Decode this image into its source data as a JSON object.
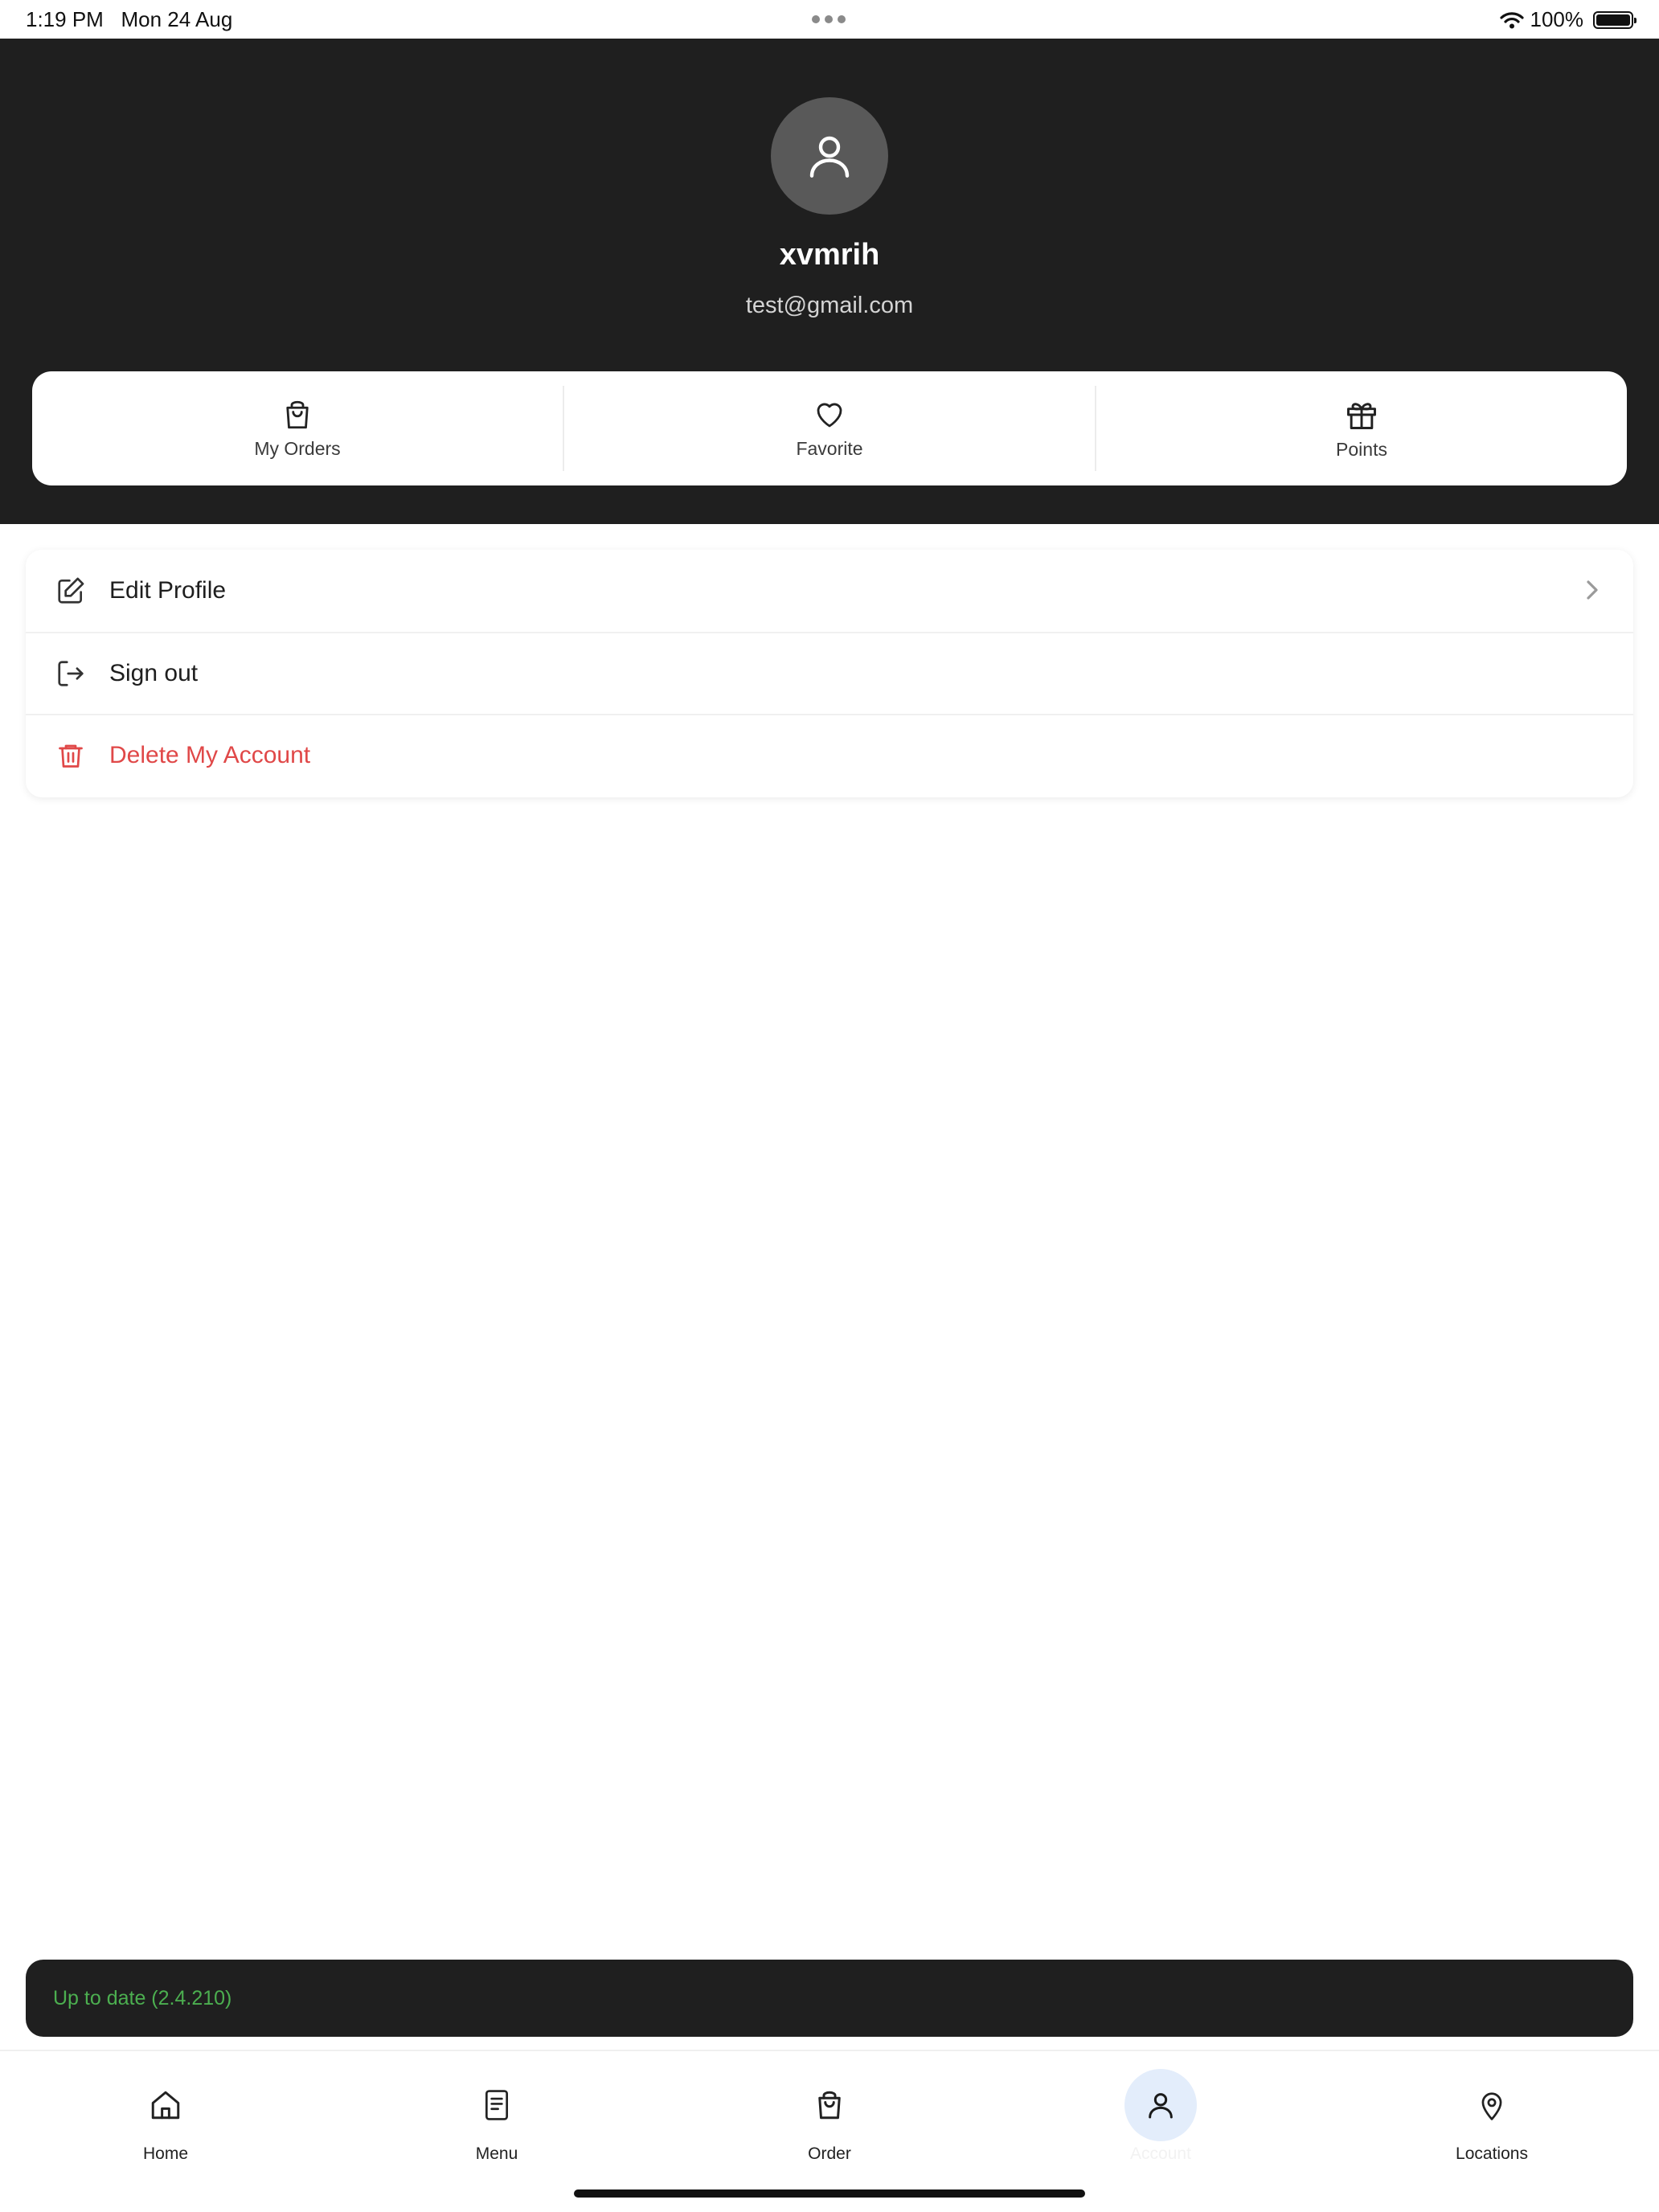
{
  "status_bar": {
    "time": "1:19 PM",
    "date": "Mon 24 Aug",
    "battery": "100%",
    "battery_level": 1.0
  },
  "profile": {
    "username": "xvmrih",
    "email": "test@gmail.com",
    "avatar_icon": "user-icon"
  },
  "quick_actions": [
    {
      "label": "My Orders",
      "icon": "shopping-bag-icon"
    },
    {
      "label": "Favorite",
      "icon": "heart-icon"
    },
    {
      "label": "Points",
      "icon": "gift-icon"
    }
  ],
  "menu": {
    "items": [
      {
        "label": "Edit Profile",
        "icon": "edit-icon"
      },
      {
        "label": "Sign out",
        "icon": "sign-out-icon"
      },
      {
        "label": "Delete My Account",
        "icon": "trash-icon"
      }
    ]
  },
  "update": {
    "text": "Up to date (2.4.210)"
  },
  "tabs": [
    {
      "label": "Home",
      "icon": "home-icon"
    },
    {
      "label": "Menu",
      "icon": "menu-document-icon"
    },
    {
      "label": "Order",
      "icon": "shopping-bag-icon"
    },
    {
      "label": "Account",
      "icon": "user-icon",
      "active": true
    },
    {
      "label": "Locations",
      "icon": "map-pin-icon"
    }
  ],
  "colors": {
    "header_bg": "#1f1f1f",
    "danger": "#e04848",
    "update_text": "#4caf50",
    "active_tab_bg": "#e3edfb"
  }
}
